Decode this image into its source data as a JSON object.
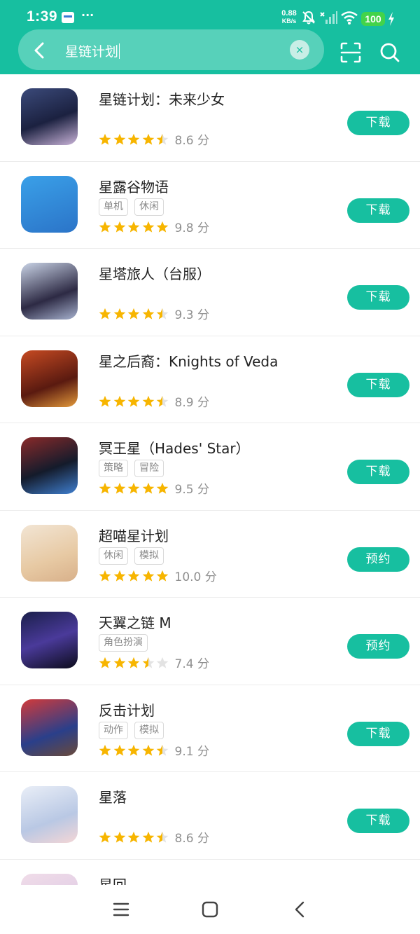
{
  "status_bar": {
    "time": "1:39",
    "dots": "···",
    "speed_value": "0.88",
    "speed_unit": "KB/s",
    "battery": "100"
  },
  "search": {
    "query": "星链计划",
    "clear_symbol": "×"
  },
  "icons": {
    "back": "back-arrow-icon",
    "clear": "clear-icon",
    "scan": "scan-icon",
    "search": "search-icon",
    "star": "star-icon",
    "nav_menu": "menu-icon",
    "nav_home": "home-icon",
    "nav_back": "back-icon"
  },
  "colors": {
    "accent": "#17bfa0",
    "star": "#f7b500",
    "star_empty": "#e3e3e3"
  },
  "apps": [
    {
      "name": "星链计划：未来少女",
      "tags": [],
      "rating": 4.5,
      "score": "8.6 分",
      "action": "下载"
    },
    {
      "name": "星露谷物语",
      "tags": [
        "单机",
        "休闲"
      ],
      "rating": 5,
      "score": "9.8 分",
      "action": "下载"
    },
    {
      "name": "星塔旅人（台服）",
      "tags": [],
      "rating": 4.5,
      "score": "9.3 分",
      "action": "下载"
    },
    {
      "name": "星之后裔：Knights of Veda",
      "tags": [],
      "rating": 4.5,
      "score": "8.9 分",
      "action": "下载"
    },
    {
      "name": "冥王星（Hades' Star）",
      "tags": [
        "策略",
        "冒险"
      ],
      "rating": 5,
      "score": "9.5 分",
      "action": "下载"
    },
    {
      "name": "超喵星计划",
      "tags": [
        "休闲",
        "模拟"
      ],
      "rating": 5,
      "score": "10.0 分",
      "action": "预约"
    },
    {
      "name": "天翼之链 M",
      "tags": [
        "角色扮演"
      ],
      "rating": 3.5,
      "score": "7.4 分",
      "action": "预约"
    },
    {
      "name": "反击计划",
      "tags": [
        "动作",
        "模拟"
      ],
      "rating": 4.5,
      "score": "9.1 分",
      "action": "下载"
    },
    {
      "name": "星落",
      "tags": [],
      "rating": 4.5,
      "score": "8.6 分",
      "action": "下载"
    },
    {
      "name": "星回",
      "tags": [],
      "rating": 0,
      "score": "",
      "action": ""
    }
  ]
}
